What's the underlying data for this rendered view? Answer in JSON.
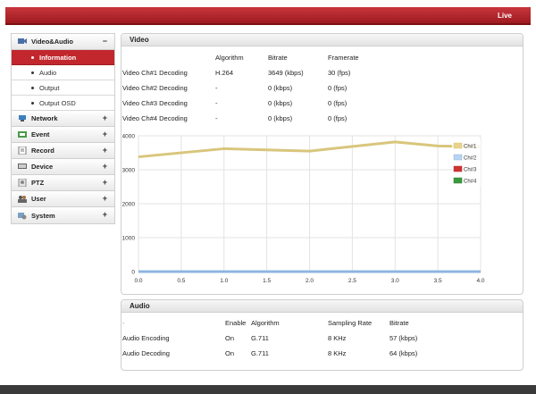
{
  "header": {
    "status": "Live"
  },
  "sidebar": {
    "sections": [
      {
        "label": "Video&Audio",
        "toggle": "−",
        "icon": "video-audio-icon",
        "expanded": true,
        "items": [
          {
            "label": "Information",
            "active": true
          },
          {
            "label": "Audio",
            "active": false
          },
          {
            "label": "Output",
            "active": false
          },
          {
            "label": "Output OSD",
            "active": false
          }
        ]
      },
      {
        "label": "Network",
        "toggle": "+",
        "icon": "network-icon"
      },
      {
        "label": "Event",
        "toggle": "+",
        "icon": "event-icon"
      },
      {
        "label": "Record",
        "toggle": "+",
        "icon": "record-icon"
      },
      {
        "label": "Device",
        "toggle": "+",
        "icon": "device-icon"
      },
      {
        "label": "PTZ",
        "toggle": "+",
        "icon": "ptz-icon"
      },
      {
        "label": "User",
        "toggle": "+",
        "icon": "user-icon"
      },
      {
        "label": "System",
        "toggle": "+",
        "icon": "system-icon"
      }
    ]
  },
  "video": {
    "title": "Video",
    "headers": [
      "Algorithm",
      "Bitrate",
      "Framerate"
    ],
    "rows": [
      {
        "name": "Video Ch#1 Decoding",
        "algorithm": "H.264",
        "bitrate": "3649 (kbps)",
        "framerate": "30 (fps)"
      },
      {
        "name": "Video Ch#2 Decoding",
        "algorithm": "-",
        "bitrate": "0 (kbps)",
        "framerate": "0 (fps)"
      },
      {
        "name": "Video Ch#3 Decoding",
        "algorithm": "-",
        "bitrate": "0 (kbps)",
        "framerate": "0 (fps)"
      },
      {
        "name": "Video Ch#4 Decoding",
        "algorithm": "-",
        "bitrate": "0 (kbps)",
        "framerate": "0 (fps)"
      }
    ]
  },
  "chart_data": {
    "type": "line",
    "x": [
      0,
      0.5,
      1.0,
      1.5,
      2.0,
      2.5,
      3.0,
      3.5,
      4.0
    ],
    "xticks": [
      "0.0",
      "0.5",
      "1.0",
      "1.5",
      "2.0",
      "2.5",
      "3.0",
      "3.5",
      "4.0"
    ],
    "yticks": [
      "0",
      "1000",
      "2000",
      "3000",
      "4000"
    ],
    "xlim": [
      0,
      4.0
    ],
    "ylim": [
      0,
      4000
    ],
    "grid": true,
    "legend_position": "top-right",
    "series": [
      {
        "name": "Ch#1",
        "color": "#e8d48a",
        "stroke": "#d8c67c",
        "points": [
          [
            0,
            3380
          ],
          [
            1.0,
            3620
          ],
          [
            2.0,
            3550
          ],
          [
            3.0,
            3820
          ],
          [
            3.5,
            3700
          ],
          [
            4.0,
            3680
          ]
        ]
      },
      {
        "name": "Ch#2",
        "color": "#b9d3f0",
        "stroke": "#8fb5e0",
        "points": [
          [
            0,
            0
          ],
          [
            4.0,
            0
          ]
        ]
      },
      {
        "name": "Ch#3",
        "color": "#cc3333",
        "stroke": "#b82828",
        "points": [
          [
            0,
            0
          ],
          [
            4.0,
            0
          ]
        ]
      },
      {
        "name": "Ch#4",
        "color": "#3a9a3a",
        "stroke": "#2e7d32",
        "points": [
          [
            0,
            0
          ],
          [
            4.0,
            0
          ]
        ]
      }
    ]
  },
  "audio": {
    "title": "Audio",
    "first_header": "-",
    "headers": [
      "Enable",
      "Algorithm",
      "Sampling Rate",
      "Bitrate"
    ],
    "rows": [
      {
        "name": "Audio Encoding",
        "enable": "On",
        "algorithm": "G.711",
        "sampling": "8 KHz",
        "bitrate": "57 (kbps)"
      },
      {
        "name": "Audio Decoding",
        "enable": "On",
        "algorithm": "G.711",
        "sampling": "8 KHz",
        "bitrate": "64 (kbps)"
      }
    ]
  }
}
